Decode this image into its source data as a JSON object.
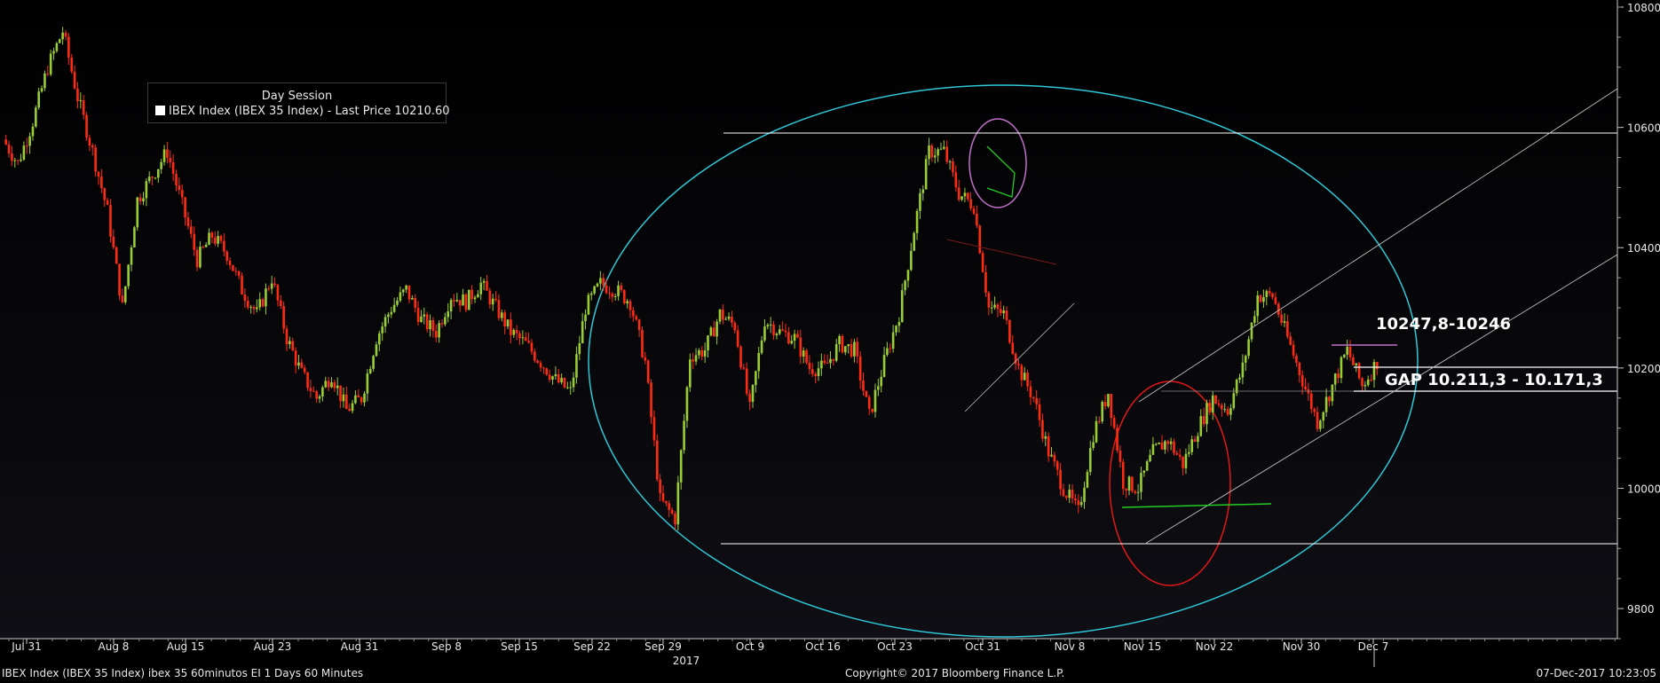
{
  "legend": {
    "title": "Day Session",
    "series_label": "IBEX Index (IBEX 35 Index) - Last Price 10210.60"
  },
  "footer": {
    "left": "IBEX Index (IBEX 35 Index) ibex 35 60minutos EI 1 Days 60 Minutes",
    "center": "Copyright© 2017 Bloomberg Finance L.P.",
    "right": "07-Dec-2017 10:23:05"
  },
  "annotations": {
    "resistance_label": "10247,8-10246",
    "gap_label": "GAP 10.211,3 - 10.171,3"
  },
  "colors": {
    "up": "#9acd32",
    "down": "#ff2a12",
    "circle_big": "#2ec8d8",
    "circle_top": "#c070c8",
    "circle_bottom": "#e01818",
    "support_green": "#22cc22"
  },
  "chart_data": {
    "type": "line",
    "title": "",
    "ylim": [
      9750,
      10800
    ],
    "y_ticks": [
      9800,
      10000,
      10200,
      10400,
      10600,
      10800
    ],
    "x_tick_labels": [
      "Jul 31",
      "Aug 8",
      "Aug 15",
      "Aug 23",
      "Aug 31",
      "Sep 8",
      "Sep 15",
      "Sep 22",
      "Sep 29",
      "Oct 9",
      "Oct 16",
      "Oct 23",
      "Oct 31",
      "Nov 8",
      "Nov 15",
      "Nov 22",
      "Nov 30",
      "Dec 7"
    ],
    "x_year_label": "2017",
    "series": [
      {
        "values": [
          10580,
          10540,
          10610,
          10700,
          10760,
          10650,
          10560,
          10460,
          10300,
          10480,
          10520,
          10560,
          10470,
          10380,
          10420,
          10390,
          10330,
          10290,
          10350,
          10250,
          10190,
          10150,
          10190,
          10130,
          10150,
          10250,
          10300,
          10330,
          10280,
          10260,
          10320,
          10310,
          10340,
          10300,
          10260,
          10240,
          10210,
          10180,
          10160,
          10300,
          10340,
          10330,
          10310,
          10210,
          9980,
          9950,
          10220,
          10230,
          10290,
          10270,
          10130,
          10280,
          10260,
          10250,
          10200,
          10200,
          10240,
          10230,
          10120,
          10210,
          10290,
          10430,
          10560,
          10560,
          10490,
          10470,
          10300,
          10290,
          10200,
          10150,
          10060,
          10000,
          9960,
          10090,
          10160,
          10010,
          10000,
          10060,
          10080,
          10040,
          10100,
          10150,
          10130,
          10200,
          10320,
          10320,
          10250,
          10180,
          10110,
          10170,
          10230,
          10170,
          10210
        ]
      }
    ],
    "annotated_levels": [
      {
        "label": "10247,8-10246",
        "value": 10247
      },
      {
        "label": "GAP 10.211,3 - 10.171,3",
        "value_high": 10211.3,
        "value_low": 10171.3
      }
    ]
  }
}
